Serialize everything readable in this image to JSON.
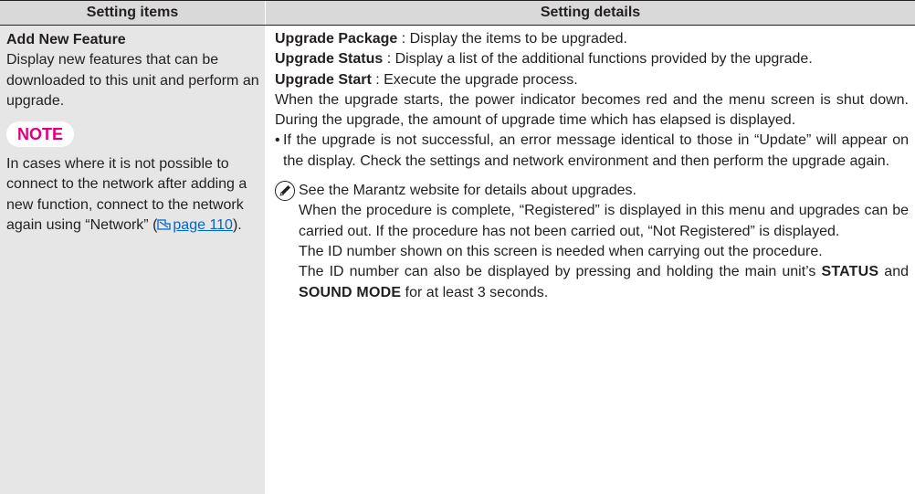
{
  "header": {
    "items_label": "Setting items",
    "details_label": "Setting details"
  },
  "left": {
    "title": "Add New Feature",
    "description": "Display new features that can be downloaded to this unit and perform an upgrade.",
    "note_label": "NOTE",
    "note_text_before": "In cases where it is not possible to connect to the network after adding a new function, connect to the network again using “Network” (",
    "note_link": "page 110",
    "note_text_after": ")."
  },
  "right": {
    "upgrade_package_label": "Upgrade Package",
    "upgrade_package_text": " : Display the items to be upgraded.",
    "upgrade_status_label": "Upgrade Status",
    "upgrade_status_text": " : Display a list of the additional functions provided by the upgrade.",
    "upgrade_start_label": "Upgrade Start",
    "upgrade_start_text": " : Execute the upgrade process.",
    "upgrade_info": "When the upgrade starts, the power indicator becomes red and the menu screen is shut down. During the upgrade, the amount of upgrade time which has elapsed is displayed.",
    "bullet_mark": "•",
    "bullet_text": "If the upgrade is not successful, an error message identical to those in “Update” will appear on the display. Check the settings and network environment and then perform the upgrade again.",
    "tip_line1": "See the Marantz website for details about upgrades.",
    "tip_line2": "When the procedure is complete, “Registered” is displayed in this menu and upgrades can be carried out. If the procedure has not been carried out, “Not Registered” is displayed.",
    "tip_line3": "The ID number shown on this screen is needed when carrying out the procedure.",
    "tip_line4_before": "The ID number can also be displayed by pressing and holding the main unit’s ",
    "tip_status": "STATUS",
    "tip_and": " and ",
    "tip_sound_mode": "SOUND MODE",
    "tip_line4_after": " for at least 3 seconds."
  },
  "colors": {
    "header_bg": "#d9d9d9",
    "left_bg": "#e6e6e6",
    "note_accent": "#e0007a",
    "link": "#0066cc"
  }
}
